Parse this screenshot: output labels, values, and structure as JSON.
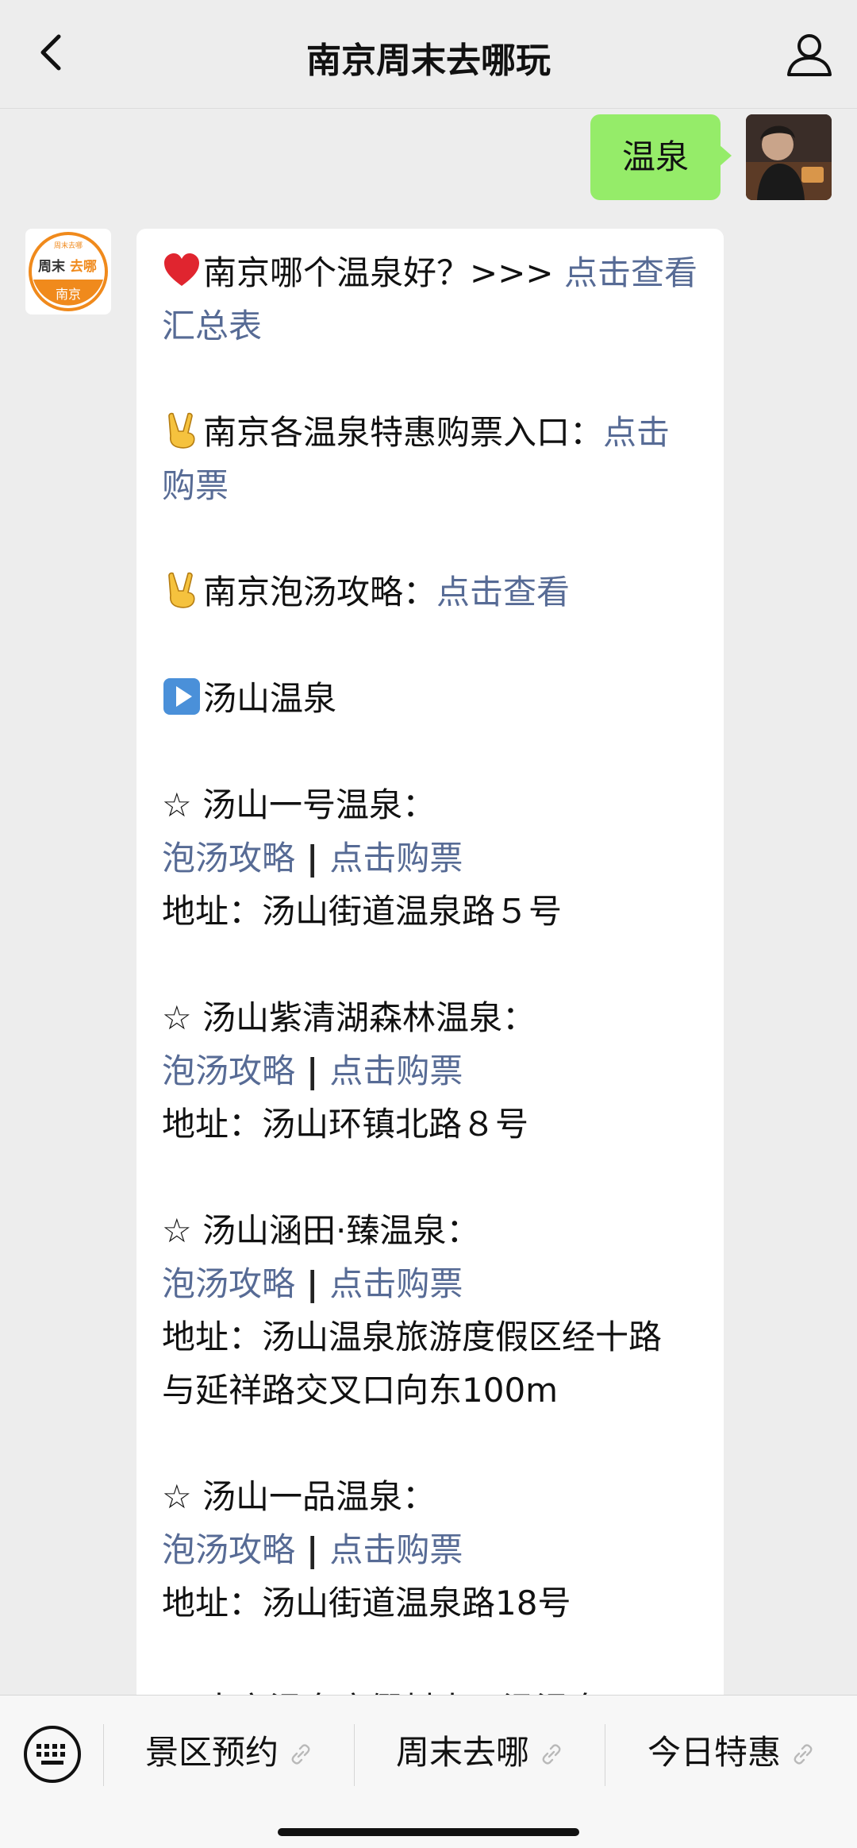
{
  "header": {
    "title": "南京周末去哪玩",
    "back_icon": "chevron-left-icon",
    "profile_icon": "person-icon"
  },
  "chat": {
    "outgoing": {
      "text": "温泉"
    },
    "bot_avatar": {
      "top": "周末去哪",
      "middle_a": "周末",
      "middle_b": "去哪",
      "bottom": "南京",
      "tiny": "周末去哪"
    },
    "incoming": {
      "intro": {
        "text": "南京哪个温泉好？>>> ",
        "link1": "点击查看",
        "link2": "汇总表"
      },
      "buy": {
        "text": "南京各温泉特惠购票入口：",
        "link1": "点击",
        "link2": "购票"
      },
      "guide": {
        "text": "南京泡汤攻略：",
        "link": "点击查看"
      },
      "section_title": "汤山温泉",
      "star": "☆",
      "strategy_label": "泡汤攻略",
      "buy_label": "点击购票",
      "separator": "|",
      "spots": [
        {
          "name": "汤山一号温泉：",
          "address": [
            "地址：汤山街道温泉路５号"
          ]
        },
        {
          "name": "汤山紫清湖森林温泉：",
          "address": [
            "地址：汤山环镇北路８号"
          ]
        },
        {
          "name": "汤山涵田·臻温泉：",
          "address": [
            "地址：汤山温泉旅游度假区经十路",
            "与延祥路交叉口向东100m"
          ]
        },
        {
          "name": "汤山一品温泉：",
          "address": [
            "地址：汤山街道温泉路18号"
          ]
        }
      ],
      "cut_line": "☆ 南京温泉度假村十子汤温泉"
    }
  },
  "bottom_menu": {
    "keyboard_icon": "keyboard-icon",
    "items": [
      {
        "label": "景区预约"
      },
      {
        "label": "周末去哪"
      },
      {
        "label": "今日特惠"
      }
    ]
  },
  "colors": {
    "link": "#576b95",
    "outgoing_bubble": "#95ec69",
    "background": "#ededed",
    "brand_orange": "#f08a1c"
  }
}
